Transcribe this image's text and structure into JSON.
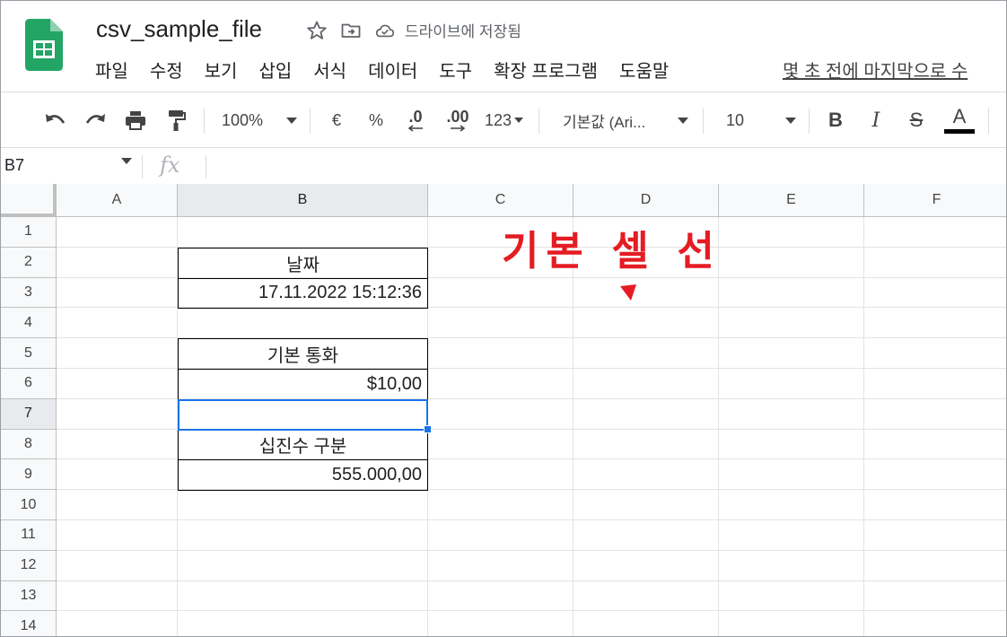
{
  "header": {
    "doc_title": "csv_sample_file",
    "saved_status": "드라이브에 저장됨",
    "last_edit": "몇 초 전에 마지막으로 수",
    "menu": [
      "파일",
      "수정",
      "보기",
      "삽입",
      "서식",
      "데이터",
      "도구",
      "확장 프로그램",
      "도움말"
    ]
  },
  "toolbar": {
    "zoom": "100%",
    "currency": "€",
    "percent": "%",
    "dec_decrease": ".0",
    "dec_increase": ".00",
    "more_formats": "123",
    "font": "기본값 (Ari...",
    "font_size": "10",
    "bold": "B",
    "italic": "I",
    "strike": "S",
    "text_color": "A"
  },
  "formula_bar": {
    "name_box": "B7",
    "fx": "fx",
    "content": ""
  },
  "sheet": {
    "columns": [
      "A",
      "B",
      "C",
      "D",
      "E",
      "F"
    ],
    "rows": [
      "1",
      "2",
      "3",
      "4",
      "5",
      "6",
      "7",
      "8",
      "9",
      "10",
      "11",
      "12",
      "13",
      "14"
    ],
    "selected_cell": "B7",
    "cells": {
      "B2": "날짜",
      "B3": "17.11.2022 15:12:36",
      "B5": "기본 통화",
      "B6": "$10,00",
      "B8": "십진수 구분",
      "B9": "555.000,00"
    }
  },
  "annotation": {
    "text": "기본 셀 선",
    "color": "#e51c23"
  },
  "colors": {
    "selection": "#1a73e8",
    "logo_green": "#23a566"
  }
}
